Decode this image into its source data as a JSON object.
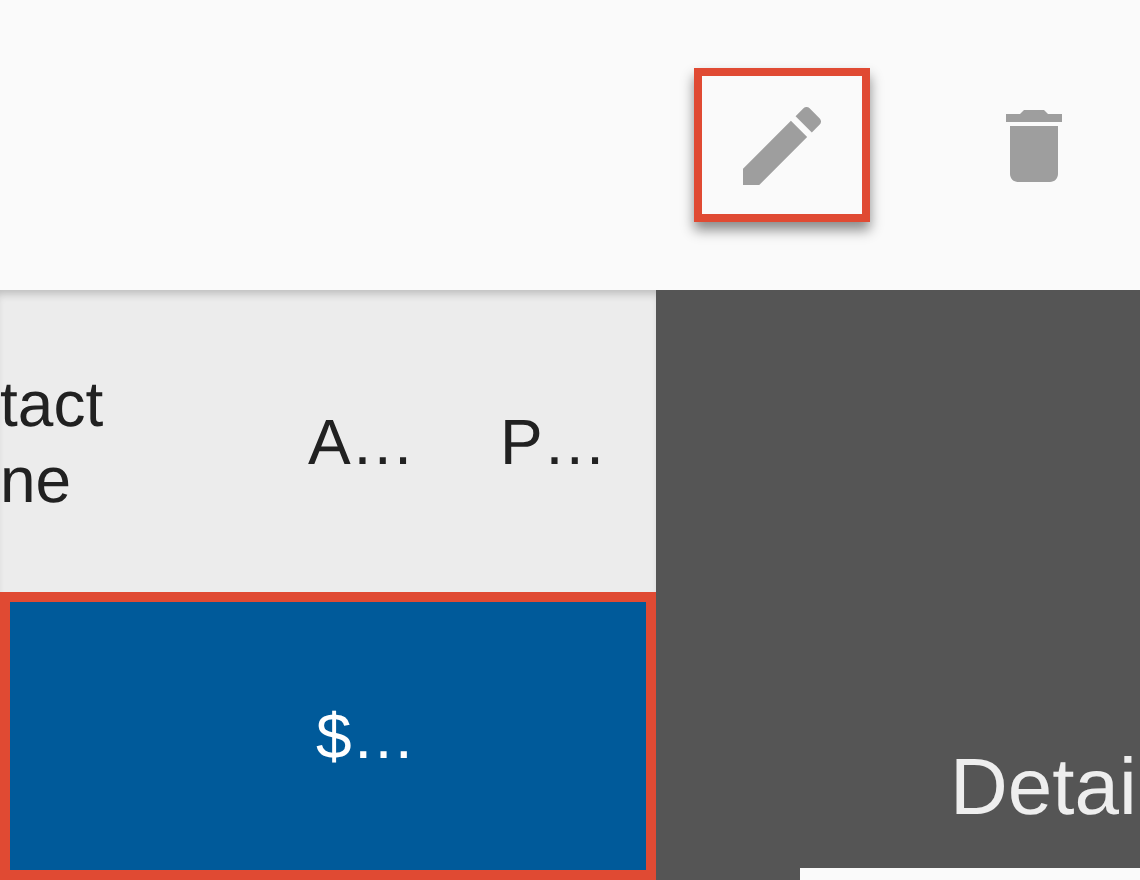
{
  "toolbar": {
    "edit_button": {
      "highlighted": true
    },
    "delete_button": {
      "highlighted": false
    }
  },
  "table": {
    "columns": [
      {
        "label": "tact\nne"
      },
      {
        "label": "A…"
      },
      {
        "label": "P…"
      }
    ],
    "rows": [
      {
        "cells": [
          "",
          "$…"
        ],
        "selected": true,
        "highlighted": true
      }
    ]
  },
  "details_panel": {
    "title": "Detai"
  }
}
